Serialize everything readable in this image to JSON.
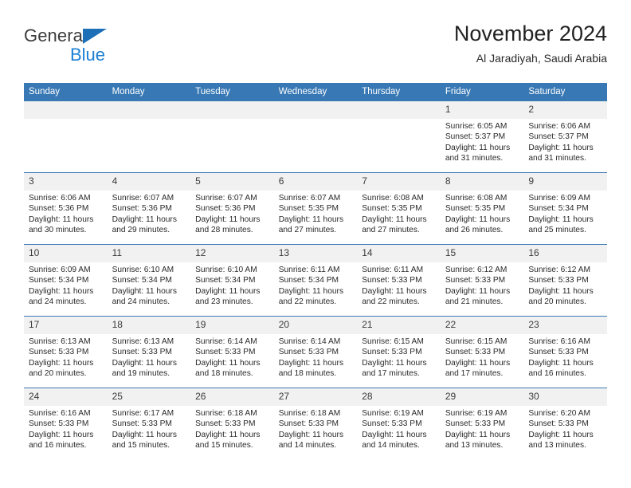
{
  "brand": {
    "name_part1": "General",
    "name_part2": "Blue",
    "accent_color": "#1b7fd4",
    "triangle_color": "#1d6fb8"
  },
  "header": {
    "title": "November 2024",
    "subtitle": "Al Jaradiyah, Saudi Arabia",
    "header_bg_color": "#3878b4",
    "daynum_bg_color": "#f1f1f1"
  },
  "weekday_headers": [
    "Sunday",
    "Monday",
    "Tuesday",
    "Wednesday",
    "Thursday",
    "Friday",
    "Saturday"
  ],
  "weeks": [
    [
      {
        "day": "",
        "empty": true
      },
      {
        "day": "",
        "empty": true
      },
      {
        "day": "",
        "empty": true
      },
      {
        "day": "",
        "empty": true
      },
      {
        "day": "",
        "empty": true
      },
      {
        "day": "1",
        "sunrise": "Sunrise: 6:05 AM",
        "sunset": "Sunset: 5:37 PM",
        "daylight_line1": "Daylight: 11 hours",
        "daylight_line2": "and 31 minutes."
      },
      {
        "day": "2",
        "sunrise": "Sunrise: 6:06 AM",
        "sunset": "Sunset: 5:37 PM",
        "daylight_line1": "Daylight: 11 hours",
        "daylight_line2": "and 31 minutes."
      }
    ],
    [
      {
        "day": "3",
        "sunrise": "Sunrise: 6:06 AM",
        "sunset": "Sunset: 5:36 PM",
        "daylight_line1": "Daylight: 11 hours",
        "daylight_line2": "and 30 minutes."
      },
      {
        "day": "4",
        "sunrise": "Sunrise: 6:07 AM",
        "sunset": "Sunset: 5:36 PM",
        "daylight_line1": "Daylight: 11 hours",
        "daylight_line2": "and 29 minutes."
      },
      {
        "day": "5",
        "sunrise": "Sunrise: 6:07 AM",
        "sunset": "Sunset: 5:36 PM",
        "daylight_line1": "Daylight: 11 hours",
        "daylight_line2": "and 28 minutes."
      },
      {
        "day": "6",
        "sunrise": "Sunrise: 6:07 AM",
        "sunset": "Sunset: 5:35 PM",
        "daylight_line1": "Daylight: 11 hours",
        "daylight_line2": "and 27 minutes."
      },
      {
        "day": "7",
        "sunrise": "Sunrise: 6:08 AM",
        "sunset": "Sunset: 5:35 PM",
        "daylight_line1": "Daylight: 11 hours",
        "daylight_line2": "and 27 minutes."
      },
      {
        "day": "8",
        "sunrise": "Sunrise: 6:08 AM",
        "sunset": "Sunset: 5:35 PM",
        "daylight_line1": "Daylight: 11 hours",
        "daylight_line2": "and 26 minutes."
      },
      {
        "day": "9",
        "sunrise": "Sunrise: 6:09 AM",
        "sunset": "Sunset: 5:34 PM",
        "daylight_line1": "Daylight: 11 hours",
        "daylight_line2": "and 25 minutes."
      }
    ],
    [
      {
        "day": "10",
        "sunrise": "Sunrise: 6:09 AM",
        "sunset": "Sunset: 5:34 PM",
        "daylight_line1": "Daylight: 11 hours",
        "daylight_line2": "and 24 minutes."
      },
      {
        "day": "11",
        "sunrise": "Sunrise: 6:10 AM",
        "sunset": "Sunset: 5:34 PM",
        "daylight_line1": "Daylight: 11 hours",
        "daylight_line2": "and 24 minutes."
      },
      {
        "day": "12",
        "sunrise": "Sunrise: 6:10 AM",
        "sunset": "Sunset: 5:34 PM",
        "daylight_line1": "Daylight: 11 hours",
        "daylight_line2": "and 23 minutes."
      },
      {
        "day": "13",
        "sunrise": "Sunrise: 6:11 AM",
        "sunset": "Sunset: 5:34 PM",
        "daylight_line1": "Daylight: 11 hours",
        "daylight_line2": "and 22 minutes."
      },
      {
        "day": "14",
        "sunrise": "Sunrise: 6:11 AM",
        "sunset": "Sunset: 5:33 PM",
        "daylight_line1": "Daylight: 11 hours",
        "daylight_line2": "and 22 minutes."
      },
      {
        "day": "15",
        "sunrise": "Sunrise: 6:12 AM",
        "sunset": "Sunset: 5:33 PM",
        "daylight_line1": "Daylight: 11 hours",
        "daylight_line2": "and 21 minutes."
      },
      {
        "day": "16",
        "sunrise": "Sunrise: 6:12 AM",
        "sunset": "Sunset: 5:33 PM",
        "daylight_line1": "Daylight: 11 hours",
        "daylight_line2": "and 20 minutes."
      }
    ],
    [
      {
        "day": "17",
        "sunrise": "Sunrise: 6:13 AM",
        "sunset": "Sunset: 5:33 PM",
        "daylight_line1": "Daylight: 11 hours",
        "daylight_line2": "and 20 minutes."
      },
      {
        "day": "18",
        "sunrise": "Sunrise: 6:13 AM",
        "sunset": "Sunset: 5:33 PM",
        "daylight_line1": "Daylight: 11 hours",
        "daylight_line2": "and 19 minutes."
      },
      {
        "day": "19",
        "sunrise": "Sunrise: 6:14 AM",
        "sunset": "Sunset: 5:33 PM",
        "daylight_line1": "Daylight: 11 hours",
        "daylight_line2": "and 18 minutes."
      },
      {
        "day": "20",
        "sunrise": "Sunrise: 6:14 AM",
        "sunset": "Sunset: 5:33 PM",
        "daylight_line1": "Daylight: 11 hours",
        "daylight_line2": "and 18 minutes."
      },
      {
        "day": "21",
        "sunrise": "Sunrise: 6:15 AM",
        "sunset": "Sunset: 5:33 PM",
        "daylight_line1": "Daylight: 11 hours",
        "daylight_line2": "and 17 minutes."
      },
      {
        "day": "22",
        "sunrise": "Sunrise: 6:15 AM",
        "sunset": "Sunset: 5:33 PM",
        "daylight_line1": "Daylight: 11 hours",
        "daylight_line2": "and 17 minutes."
      },
      {
        "day": "23",
        "sunrise": "Sunrise: 6:16 AM",
        "sunset": "Sunset: 5:33 PM",
        "daylight_line1": "Daylight: 11 hours",
        "daylight_line2": "and 16 minutes."
      }
    ],
    [
      {
        "day": "24",
        "sunrise": "Sunrise: 6:16 AM",
        "sunset": "Sunset: 5:33 PM",
        "daylight_line1": "Daylight: 11 hours",
        "daylight_line2": "and 16 minutes."
      },
      {
        "day": "25",
        "sunrise": "Sunrise: 6:17 AM",
        "sunset": "Sunset: 5:33 PM",
        "daylight_line1": "Daylight: 11 hours",
        "daylight_line2": "and 15 minutes."
      },
      {
        "day": "26",
        "sunrise": "Sunrise: 6:18 AM",
        "sunset": "Sunset: 5:33 PM",
        "daylight_line1": "Daylight: 11 hours",
        "daylight_line2": "and 15 minutes."
      },
      {
        "day": "27",
        "sunrise": "Sunrise: 6:18 AM",
        "sunset": "Sunset: 5:33 PM",
        "daylight_line1": "Daylight: 11 hours",
        "daylight_line2": "and 14 minutes."
      },
      {
        "day": "28",
        "sunrise": "Sunrise: 6:19 AM",
        "sunset": "Sunset: 5:33 PM",
        "daylight_line1": "Daylight: 11 hours",
        "daylight_line2": "and 14 minutes."
      },
      {
        "day": "29",
        "sunrise": "Sunrise: 6:19 AM",
        "sunset": "Sunset: 5:33 PM",
        "daylight_line1": "Daylight: 11 hours",
        "daylight_line2": "and 13 minutes."
      },
      {
        "day": "30",
        "sunrise": "Sunrise: 6:20 AM",
        "sunset": "Sunset: 5:33 PM",
        "daylight_line1": "Daylight: 11 hours",
        "daylight_line2": "and 13 minutes."
      }
    ]
  ]
}
